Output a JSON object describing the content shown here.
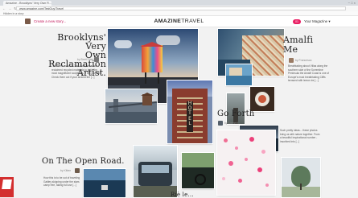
{
  "browser": {
    "tab_title": "Amazine - Brooklyns' Very Own R...",
    "url": "www.amazine.com/TestGuy/Travel",
    "bookmarks_label": "Hidden in a story",
    "controls": "− □ ×",
    "nav": "← → ↻"
  },
  "header": {
    "create_label": "Create a new story...",
    "logo_bold": "AMAZINE",
    "logo_light": "TRAVEL",
    "notification_count": "01",
    "magazine_label": "Your Magazine ▾"
  },
  "articles": {
    "brooklyn": {
      "title_line1": "Brooklyns' Very",
      "title_line2": "Own Reclamation",
      "title_line3": "Artist.",
      "byline": "by Brett Plant",
      "excerpt": "This is the works of Tom Fruin, who uses reclaimed recycled materials to build the most magnificent sculptures. It only doesn't Check them out if your around the [...]"
    },
    "amalfi": {
      "title_line1": "Amalfi",
      "title_line2": "Me",
      "byline": "by Francesca",
      "excerpt": "Breathtaking about Villas along the southern side of the Sorrentine Peninsula the Amalfi Coast is one of Europe's most breathtaking Cliffs terraced with lemon tre [...]"
    },
    "goforth": {
      "title": "Go Forth",
      "byline": "by Clement",
      "excerpt": "Such pretty ideas... these photos bring us with nature together. From a beautiful inspirational number - inscribed into [...]"
    },
    "openroad": {
      "title": "On The Open Road.",
      "byline": "by Kitten",
      "excerpt": "How this is to be out of traveling Gaitley skipping under the stars camp free, taking full use [...]"
    },
    "bottom_partial": {
      "title": "Riè le..."
    }
  },
  "colors": {
    "accent": "#e91e63",
    "create": "#c2185b",
    "badge_red": "#d32f2f"
  },
  "icons": [
    "back-icon",
    "forward-icon",
    "reload-icon",
    "notification-badge",
    "author-avatar"
  ]
}
